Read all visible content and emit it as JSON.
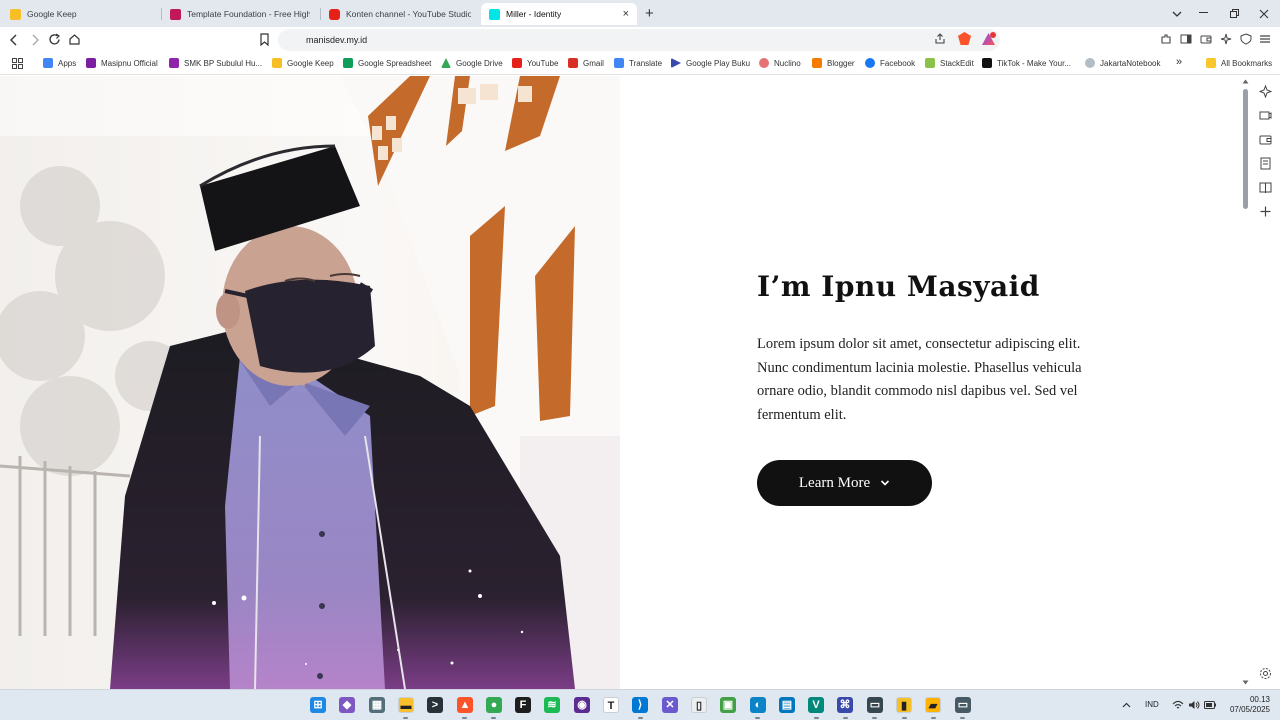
{
  "browser": {
    "tabs": [
      {
        "label": "Google Keep",
        "favicon_color": "#f6bf26"
      },
      {
        "label": "Template Foundation - Free High Q",
        "favicon_color": "#c2185b"
      },
      {
        "label": "Konten channel - YouTube Studio",
        "favicon_color": "#e62117"
      },
      {
        "label": "Miller - Identity",
        "favicon_color": "#00e5e5",
        "active": true
      }
    ],
    "url": "manisdev.my.id",
    "new_tab_symbol": "+",
    "close_symbol": "×"
  },
  "bookmarks": {
    "items": [
      {
        "label": "Apps",
        "color": "#4285f4"
      },
      {
        "label": "Masipnu Official",
        "color": "#7b1fa2"
      },
      {
        "label": "SMK BP Subulul Hu...",
        "color": "#8e24aa"
      },
      {
        "label": "Google Keep",
        "color": "#f6bf26"
      },
      {
        "label": "Google Spreadsheet",
        "color": "#0f9d58"
      },
      {
        "label": "Google Drive",
        "color": "#34a853"
      },
      {
        "label": "YouTube",
        "color": "#e62117"
      },
      {
        "label": "Gmail",
        "color": "#d93025"
      },
      {
        "label": "Translate",
        "color": "#4285f4"
      },
      {
        "label": "Google Play Buku",
        "color": "#3949ab"
      },
      {
        "label": "Nuclino",
        "color": "#e57373"
      },
      {
        "label": "Blogger",
        "color": "#f57c00"
      },
      {
        "label": "Facebook",
        "color": "#1877f2"
      },
      {
        "label": "StackEdit",
        "color": "#8bc34a"
      },
      {
        "label": "TikTok - Make Your...",
        "color": "#111111"
      },
      {
        "label": "JakartaNotebook",
        "color": "#b0bec5"
      }
    ],
    "all_bookmarks": "All Bookmarks",
    "overflow_symbol": "»"
  },
  "hero": {
    "title": "I’m Ipnu Masyaid",
    "text": "Lorem ipsum dolor sit amet, consectetur adipiscing elit. Nunc condimentum lacinia molestie. Phasellus vehicula ornare odio, blandit commodo nisl dapibus vel. Sed vel fermentum elit.",
    "button_label": "Learn More"
  },
  "taskbar": {
    "language": "IND",
    "time": "00.13",
    "date": "07/05/2025",
    "apps": [
      {
        "name": "start",
        "color": "#1e88e5",
        "glyph": "⊞"
      },
      {
        "name": "copilot",
        "color": "#7e57c2",
        "glyph": "◆"
      },
      {
        "name": "calculator",
        "color": "#546e7a",
        "glyph": "▦"
      },
      {
        "name": "file-explorer",
        "color": "#fbc02d",
        "glyph": "▬"
      },
      {
        "name": "terminal",
        "color": "#263238",
        "glyph": ">"
      },
      {
        "name": "brave",
        "color": "#fb542b",
        "glyph": "▲"
      },
      {
        "name": "chrome",
        "color": "#34a853",
        "glyph": "●"
      },
      {
        "name": "figma",
        "color": "#1e1e1e",
        "glyph": "F"
      },
      {
        "name": "spotify",
        "color": "#1db954",
        "glyph": "≋"
      },
      {
        "name": "github",
        "color": "#5c2d91",
        "glyph": "◉"
      },
      {
        "name": "typora",
        "color": "#ffffff",
        "glyph": "T"
      },
      {
        "name": "vscode",
        "color": "#0078d4",
        "glyph": "⟩"
      },
      {
        "name": "capcut",
        "color": "#6a5acd",
        "glyph": "✕"
      },
      {
        "name": "notepad",
        "color": "#eceff1",
        "glyph": "▯"
      },
      {
        "name": "screen-tool",
        "color": "#43a047",
        "glyph": "▣"
      },
      {
        "name": "edge",
        "color": "#0a84c6",
        "glyph": "◐"
      },
      {
        "name": "remote",
        "color": "#0277bd",
        "glyph": "▤"
      },
      {
        "name": "visual-studio",
        "color": "#00897b",
        "glyph": "V"
      },
      {
        "name": "network-tool",
        "color": "#3949ab",
        "glyph": "⌘"
      },
      {
        "name": "recorder",
        "color": "#37474f",
        "glyph": "▭"
      },
      {
        "name": "keep-app",
        "color": "#f6bf26",
        "glyph": "▮"
      },
      {
        "name": "sticky-notes",
        "color": "#ffb300",
        "glyph": "▰"
      },
      {
        "name": "monitor-app",
        "color": "#455a64",
        "glyph": "▭"
      }
    ]
  }
}
